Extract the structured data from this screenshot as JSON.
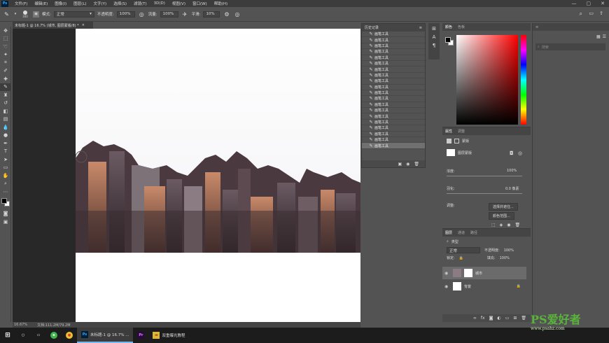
{
  "menu": {
    "logo": "Ps",
    "items": [
      "文件(F)",
      "编辑(E)",
      "图像(I)",
      "图层(L)",
      "文字(Y)",
      "选择(S)",
      "滤镜(T)",
      "3D(D)",
      "视图(V)",
      "窗口(W)",
      "帮助(H)"
    ],
    "window_buttons": [
      "—",
      "▢",
      "✕"
    ]
  },
  "options": {
    "brush_size": "300",
    "mode_label": "模式:",
    "mode_value": "正常",
    "opacity_label": "不透明度:",
    "opacity_value": "100%",
    "flow_label": "流量:",
    "flow_value": "100%",
    "smooth_label": "平滑:",
    "smooth_value": "10%"
  },
  "document": {
    "tab_title": "未标题-1 @ 16.7% (城市, 图层蒙版/8) *",
    "tab_close": "×",
    "zoom": "16.67%",
    "doc_size": "文档:111.2M/79.2M"
  },
  "history": {
    "title": "历史记录",
    "items": [
      "画笔工具",
      "画笔工具",
      "画笔工具",
      "画笔工具",
      "画笔工具",
      "画笔工具",
      "画笔工具",
      "画笔工具",
      "画笔工具",
      "画笔工具",
      "画笔工具",
      "画笔工具",
      "画笔工具",
      "画笔工具",
      "画笔工具",
      "画笔工具",
      "画笔工具",
      "画笔工具",
      "画笔工具",
      "画笔工具"
    ]
  },
  "color": {
    "tabs": [
      "颜色",
      "色板"
    ],
    "fg": "#000000",
    "bg": "#ffffff"
  },
  "properties": {
    "tabs": [
      "属性",
      "调整"
    ],
    "mask_label": "蒙版",
    "layer_mask_label": "图层蒙版",
    "density_label": "浓度:",
    "density_value": "100%",
    "feather_label": "羽化:",
    "feather_value": "0.0 像素",
    "adjust_label": "调整:",
    "select_subject": "选择并遮住...",
    "color_range": "颜色范围..."
  },
  "layers": {
    "tabs": [
      "图层",
      "通道",
      "路径"
    ],
    "kind_label": "类型",
    "blend_mode": "正常",
    "opacity_label": "不透明度:",
    "opacity_value": "100%",
    "lock_label": "锁定:",
    "fill_label": "填充:",
    "fill_value": "100%",
    "items": [
      {
        "name": "城市",
        "selected": true
      },
      {
        "name": "背景",
        "selected": false
      }
    ]
  },
  "right_column": {
    "search_placeholder": "搜索"
  },
  "taskbar": {
    "items": [
      "未标题-1 @ 16.7% ...",
      "",
      "双重曝光教程"
    ],
    "watermark": "PS爱好者",
    "watermark_url": "www.psahz.com"
  }
}
